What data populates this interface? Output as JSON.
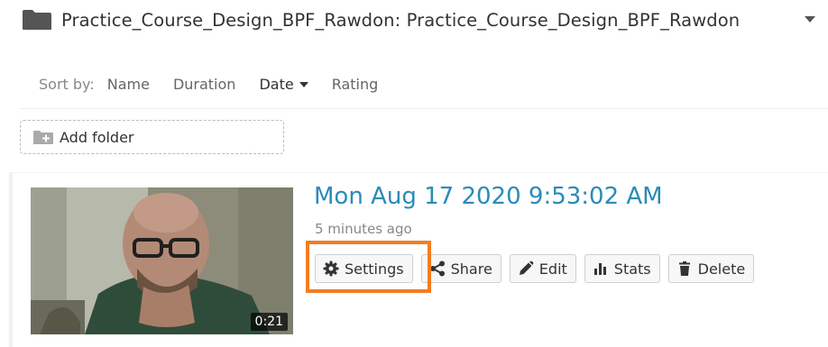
{
  "folder": {
    "title": "Practice_Course_Design_BPF_Rawdon: Practice_Course_Design_BPF_Rawdon",
    "icon": "folder-icon",
    "dropdown_icon": "caret-down-icon"
  },
  "sort": {
    "label": "Sort by:",
    "options": [
      "Name",
      "Duration",
      "Date",
      "Rating"
    ],
    "active": "Date"
  },
  "add_folder": {
    "label": "Add folder",
    "icon": "folder-plus-icon"
  },
  "video": {
    "title": "Mon Aug 17 2020 9:53:02 AM",
    "age": "5 minutes ago",
    "duration": "0:21",
    "actions": [
      {
        "label": "Settings",
        "icon": "gear-icon"
      },
      {
        "label": "Share",
        "icon": "share-icon"
      },
      {
        "label": "Edit",
        "icon": "pencil-icon"
      },
      {
        "label": "Stats",
        "icon": "bar-chart-icon"
      },
      {
        "label": "Delete",
        "icon": "trash-icon"
      }
    ]
  },
  "colors": {
    "title_link": "#2a8bb8",
    "highlight": "#f37d22"
  }
}
